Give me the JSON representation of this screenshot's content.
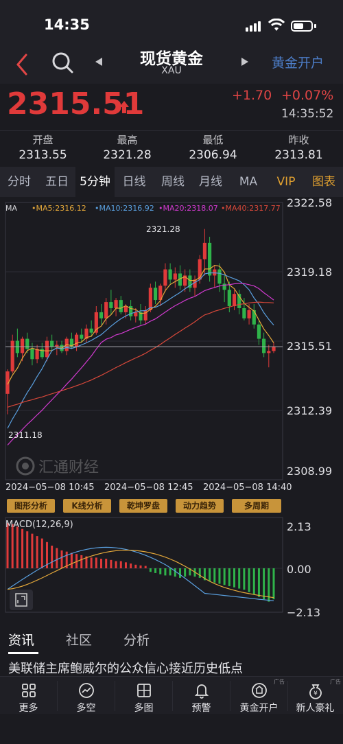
{
  "status": {
    "time": "14:35"
  },
  "nav": {
    "title": "现货黄金",
    "subtitle": "XAU",
    "open_account": "黄金开户"
  },
  "quote": {
    "price": "2315.51",
    "change": "+1.70",
    "change_pct": "+0.07%",
    "time": "14:35:52"
  },
  "stats": [
    {
      "label": "开盘",
      "value": "2313.55"
    },
    {
      "label": "最高",
      "value": "2321.28"
    },
    {
      "label": "最低",
      "value": "2306.94"
    },
    {
      "label": "昨收",
      "value": "2313.81"
    }
  ],
  "tabs": [
    "分时",
    "五日",
    "5分钟",
    "日线",
    "周线",
    "月线",
    "MA",
    "VIP",
    "图表"
  ],
  "active_tab": "5分钟",
  "chart": {
    "ma_labels": {
      "ma": "MA",
      "ma5": "•MA5:2316.12",
      "ma10": "•MA10:2316.92",
      "ma20": "•MA20:2318.07",
      "ma40": "•MA40:2317.77"
    },
    "y_ticks": [
      "2322.58",
      "2319.18",
      "2315.51",
      "2312.39",
      "2308.99"
    ],
    "x_ticks": [
      "2024−05−08 10:45",
      "2024−05−08 12:45",
      "2024−05−08 14:40"
    ],
    "high_label": "2321.28",
    "low_label": "2311.18",
    "watermark": "汇通财经",
    "macd_label": "MACD(12,26,9)",
    "macd_ticks": [
      "2.13",
      "0.00",
      "−2.13"
    ]
  },
  "tool_buttons": [
    "图形分析",
    "K线分析",
    "乾坤罗盘",
    "动力趋势",
    "多周期"
  ],
  "news_tabs": [
    "资讯",
    "社区",
    "分析"
  ],
  "headline": "美联储主席鲍威尔的公众信心接近历史低点",
  "bottom_bar": [
    {
      "label": "更多",
      "icon": "grid-icon"
    },
    {
      "label": "多空",
      "icon": "trend-circle-icon"
    },
    {
      "label": "多图",
      "icon": "multi-chart-icon"
    },
    {
      "label": "预警",
      "icon": "bell-icon"
    },
    {
      "label": "黄金开户",
      "icon": "gold-account-icon",
      "ad": "广告"
    },
    {
      "label": "新人豪礼",
      "icon": "gift-money-icon",
      "ad": "广告"
    }
  ],
  "colors": {
    "up": "#e03a3a",
    "down": "#2fb34a",
    "ma5": "#e6a93a",
    "ma10": "#5aa0e0",
    "ma20": "#d23ad0",
    "ma40": "#d9483a",
    "accent": "#4d7ec9"
  },
  "chart_data": {
    "type": "candlestick",
    "interval": "5分钟",
    "ylim": [
      2308.99,
      2322.58
    ],
    "last_price": 2315.51,
    "high": 2321.28,
    "low": 2311.18,
    "candles_ohlc": [
      [
        2313.2,
        2314.4,
        2312.2,
        2314.3
      ],
      [
        2314.3,
        2316.1,
        2314.2,
        2315.8
      ],
      [
        2315.8,
        2316.4,
        2315.0,
        2315.2
      ],
      [
        2315.2,
        2316.0,
        2314.8,
        2315.9
      ],
      [
        2315.9,
        2316.2,
        2315.2,
        2315.4
      ],
      [
        2315.4,
        2315.7,
        2314.6,
        2314.9
      ],
      [
        2314.9,
        2315.6,
        2314.7,
        2315.4
      ],
      [
        2315.4,
        2315.7,
        2314.9,
        2315.0
      ],
      [
        2315.0,
        2316.0,
        2314.8,
        2315.8
      ],
      [
        2315.8,
        2316.1,
        2315.3,
        2315.5
      ],
      [
        2315.5,
        2315.8,
        2315.1,
        2315.6
      ],
      [
        2315.6,
        2315.8,
        2315.2,
        2315.3
      ],
      [
        2315.3,
        2316.0,
        2315.1,
        2315.9
      ],
      [
        2315.9,
        2316.2,
        2315.4,
        2315.5
      ],
      [
        2315.5,
        2316.2,
        2315.3,
        2316.1
      ],
      [
        2316.1,
        2316.4,
        2315.7,
        2315.9
      ],
      [
        2315.9,
        2316.6,
        2315.7,
        2316.4
      ],
      [
        2316.4,
        2316.8,
        2316.0,
        2316.2
      ],
      [
        2316.2,
        2317.5,
        2316.1,
        2317.2
      ],
      [
        2317.2,
        2317.6,
        2316.6,
        2316.9
      ],
      [
        2316.9,
        2317.9,
        2316.6,
        2317.7
      ],
      [
        2317.7,
        2318.3,
        2317.1,
        2317.4
      ],
      [
        2317.4,
        2317.9,
        2317.0,
        2317.8
      ],
      [
        2317.8,
        2318.0,
        2317.1,
        2317.2
      ],
      [
        2317.2,
        2317.6,
        2316.9,
        2317.5
      ],
      [
        2317.5,
        2317.8,
        2316.8,
        2317.0
      ],
      [
        2317.0,
        2317.4,
        2316.7,
        2317.2
      ],
      [
        2317.2,
        2317.6,
        2316.6,
        2316.8
      ],
      [
        2316.8,
        2317.5,
        2316.6,
        2317.3
      ],
      [
        2317.3,
        2318.6,
        2317.2,
        2318.4
      ],
      [
        2318.4,
        2318.7,
        2317.6,
        2317.8
      ],
      [
        2317.8,
        2318.6,
        2317.5,
        2318.5
      ],
      [
        2318.5,
        2319.6,
        2318.2,
        2319.3
      ],
      [
        2319.3,
        2319.6,
        2318.6,
        2318.8
      ],
      [
        2318.8,
        2319.4,
        2318.4,
        2319.1
      ],
      [
        2319.1,
        2319.5,
        2318.3,
        2318.5
      ],
      [
        2318.5,
        2319.3,
        2318.2,
        2319.0
      ],
      [
        2319.0,
        2319.3,
        2318.2,
        2318.4
      ],
      [
        2318.4,
        2319.0,
        2318.0,
        2318.8
      ],
      [
        2318.8,
        2320.0,
        2318.6,
        2319.8
      ],
      [
        2319.8,
        2321.28,
        2319.0,
        2320.6
      ],
      [
        2320.6,
        2320.9,
        2318.7,
        2319.0
      ],
      [
        2319.0,
        2319.5,
        2318.4,
        2319.3
      ],
      [
        2319.3,
        2319.6,
        2318.2,
        2318.6
      ],
      [
        2318.6,
        2319.0,
        2317.7,
        2318.3
      ],
      [
        2318.3,
        2318.7,
        2317.2,
        2317.5
      ],
      [
        2317.5,
        2318.3,
        2317.3,
        2318.1
      ],
      [
        2318.1,
        2318.3,
        2317.1,
        2317.4
      ],
      [
        2317.4,
        2317.9,
        2316.8,
        2316.9
      ],
      [
        2316.9,
        2317.6,
        2316.6,
        2317.3
      ],
      [
        2317.3,
        2317.6,
        2316.4,
        2316.6
      ],
      [
        2316.6,
        2316.8,
        2315.6,
        2315.9
      ],
      [
        2315.9,
        2316.2,
        2315.0,
        2315.2
      ],
      [
        2315.2,
        2315.6,
        2314.5,
        2315.3
      ],
      [
        2315.3,
        2315.7,
        2315.2,
        2315.51
      ]
    ],
    "macd_hist": [
      1.9,
      1.85,
      1.75,
      1.65,
      1.55,
      1.45,
      1.35,
      1.25,
      1.1,
      0.95,
      0.85,
      0.75,
      0.7,
      0.65,
      0.6,
      0.55,
      0.5,
      0.45,
      0.45,
      0.4,
      0.4,
      0.35,
      0.3,
      0.3,
      0.25,
      0.2,
      0.15,
      0.12,
      0.1,
      -0.15,
      -0.2,
      -0.25,
      -0.3,
      -0.3,
      -0.35,
      -0.4,
      -0.35,
      -0.3,
      -0.35,
      -0.4,
      -0.5,
      -0.55,
      -0.6,
      -0.65,
      -0.7,
      -0.75,
      -0.8,
      -0.85,
      -0.9,
      -1.0,
      -1.1,
      -1.2,
      -1.3,
      -1.4,
      -1.3
    ]
  }
}
